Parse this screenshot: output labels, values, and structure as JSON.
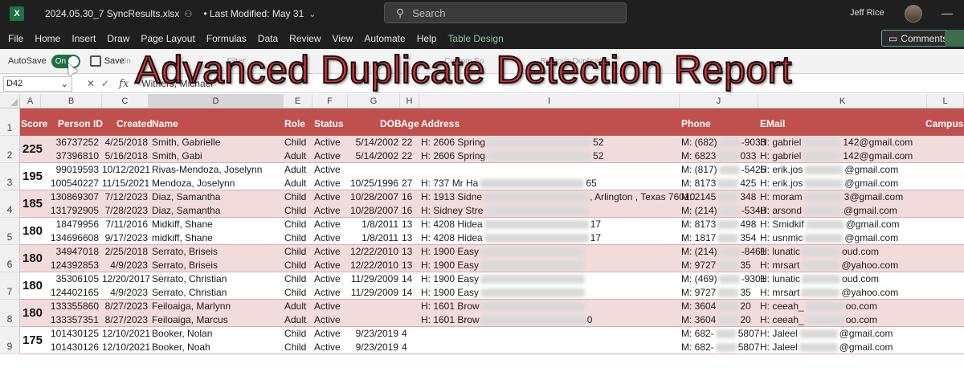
{
  "titlebar": {
    "app_icon": "excel-icon",
    "filename": "2024.05.30_7 SyncResults.xlsx",
    "last_modified": "• Last Modified: May 31",
    "search_placeholder": "Search",
    "user_name": "Jeff Rice"
  },
  "menu": {
    "items": [
      "File",
      "Home",
      "Insert",
      "Draw",
      "Page Layout",
      "Formulas",
      "Data",
      "Review",
      "View",
      "Automate",
      "Help",
      "Table Design"
    ],
    "comments_label": "Comments"
  },
  "ribbon": {
    "autosave_label": "AutoSave",
    "toggle_label": "On",
    "save_label": "Save",
    "undo_label": "Un",
    "filter_label": "Filter",
    "custom_label": "Custom So",
    "remove_dup_label": "Remove Duplicates"
  },
  "formula_bar": {
    "name_box": "D42",
    "formula_value": "Withers, Michael"
  },
  "banner": {
    "title": "Advanced Duplicate Detection Report"
  },
  "columns": [
    "A",
    "B",
    "C",
    "D",
    "E",
    "F",
    "G",
    "H",
    "I",
    "J",
    "K",
    "L"
  ],
  "headers": {
    "score": "Score",
    "person_id": "Person ID",
    "created": "Created",
    "name": "Name",
    "role": "Role",
    "status": "Status",
    "dob": "DOB",
    "age": "Age",
    "address": "Address",
    "phone": "Phone",
    "email": "EMail",
    "campus": "Campus"
  },
  "groups": [
    {
      "row_num": "2",
      "score": "225",
      "people": [
        {
          "id": "36737252",
          "created": "4/25/2018",
          "name": "Smith, Gabrielle",
          "role": "Child",
          "status": "Active",
          "dob": "5/14/2002",
          "age": "22",
          "addr_a": "H: 2606 Spring",
          "addr_b": "52",
          "phone_a": "M: (682)",
          "phone_b": "-9033",
          "email_a": "H: gabriel",
          "email_b": "142@gmail.com"
        },
        {
          "id": "37396810",
          "created": "5/16/2018",
          "name": "Smith, Gabi",
          "role": "Adult",
          "status": "Active",
          "dob": "5/14/2002",
          "age": "22",
          "addr_a": "H: 2606 Spring",
          "addr_b": "52",
          "phone_a": "M: 6823",
          "phone_b": "033",
          "email_a": "H: gabriel",
          "email_b": "142@gmail.com"
        }
      ]
    },
    {
      "row_num": "3",
      "score": "195",
      "people": [
        {
          "id": "99019593",
          "created": "10/12/2021",
          "name": "Rivas-Mendoza, Joselynn",
          "role": "Adult",
          "status": "Active",
          "dob": "",
          "age": "",
          "addr_a": "",
          "addr_b": "",
          "phone_a": "M: (817)",
          "phone_b": "-5425",
          "email_a": "H: erik.jos",
          "email_b": "@gmail.com"
        },
        {
          "id": "100540227",
          "created": "11/15/2021",
          "name": "Mendoza, Joselynn",
          "role": "Adult",
          "status": "Active",
          "dob": "10/25/1996",
          "age": "27",
          "addr_a": "H: 737 Mr Ha",
          "addr_b": "65",
          "phone_a": "M: 8173",
          "phone_b": "425",
          "email_a": "H: erik.jos",
          "email_b": "@gmail.com"
        }
      ]
    },
    {
      "row_num": "4",
      "score": "185",
      "people": [
        {
          "id": "130869307",
          "created": "7/12/2023",
          "name": "Diaz, Samantha",
          "role": "Child",
          "status": "Active",
          "dob": "10/28/2007",
          "age": "16",
          "addr_a": "H: 1913 Sidne",
          "addr_b": ", Arlington , Texas 76010",
          "phone_a": "M: 2145",
          "phone_b": "348",
          "email_a": "H: moram",
          "email_b": "3@gmail.com"
        },
        {
          "id": "131792905",
          "created": "7/28/2023",
          "name": "Diaz, Samantha",
          "role": "Child",
          "status": "Active",
          "dob": "10/28/2007",
          "age": "16",
          "addr_a": "H: Sidney Stre",
          "addr_b": "",
          "phone_a": "M: (214)",
          "phone_b": "-5348",
          "email_a": "H: arsond",
          "email_b": "@gmail.com"
        }
      ]
    },
    {
      "row_num": "5",
      "score": "180",
      "people": [
        {
          "id": "18479956",
          "created": "7/11/2016",
          "name": "Midkiff, Shane",
          "role": "Child",
          "status": "Active",
          "dob": "1/8/2011",
          "age": "13",
          "addr_a": "H: 4208 Hidea",
          "addr_b": "17",
          "phone_a": "M: 8173",
          "phone_b": "498",
          "email_a": "H: Smidkif",
          "email_b": "@gmail.com"
        },
        {
          "id": "134696608",
          "created": "9/17/2023",
          "name": "midkiff, Shane",
          "role": "Child",
          "status": "Active",
          "dob": "1/8/2011",
          "age": "13",
          "addr_a": "H: 4208 Hidea",
          "addr_b": "17",
          "phone_a": "M: 1817",
          "phone_b": "354",
          "email_a": "H: usnmic",
          "email_b": "@gmail.com"
        }
      ]
    },
    {
      "row_num": "6",
      "score": "180",
      "people": [
        {
          "id": "34947018",
          "created": "2/25/2018",
          "name": "Serrato, Briseis",
          "role": "Child",
          "status": "Active",
          "dob": "12/22/2010",
          "age": "13",
          "addr_a": "H: 1900 Easy",
          "addr_b": "",
          "phone_a": "M: (214)",
          "phone_b": "-8461",
          "email_a": "H: lunatic",
          "email_b": "oud.com"
        },
        {
          "id": "124392853",
          "created": "4/9/2023",
          "name": "Serrato, Briseis",
          "role": "Child",
          "status": "Active",
          "dob": "12/22/2010",
          "age": "13",
          "addr_a": "H: 1900 Easy",
          "addr_b": "",
          "phone_a": "M: 9727",
          "phone_b": "35",
          "email_a": "H: mrsart",
          "email_b": "@yahoo.com"
        }
      ]
    },
    {
      "row_num": "7",
      "score": "180",
      "people": [
        {
          "id": "35306105",
          "created": "12/20/2017",
          "name": "Serrato, Christian",
          "role": "Child",
          "status": "Active",
          "dob": "11/29/2009",
          "age": "14",
          "addr_a": "H: 1900 Easy",
          "addr_b": "",
          "phone_a": "M: (469)",
          "phone_b": "-9301",
          "email_a": "H: lunatic",
          "email_b": "oud.com"
        },
        {
          "id": "124402165",
          "created": "4/9/2023",
          "name": "Serrato, Christian",
          "role": "Child",
          "status": "Active",
          "dob": "11/29/2009",
          "age": "14",
          "addr_a": "H: 1900 Easy",
          "addr_b": "",
          "phone_a": "M: 9727",
          "phone_b": "35",
          "email_a": "H: mrsart",
          "email_b": "@yahoo.com"
        }
      ]
    },
    {
      "row_num": "8",
      "score": "180",
      "people": [
        {
          "id": "133355860",
          "created": "8/27/2023",
          "name": "Feiloaiga, Marlynn",
          "role": "Adult",
          "status": "Active",
          "dob": "",
          "age": "",
          "addr_a": "H: 1601 Brow",
          "addr_b": "",
          "phone_a": "M: 3604",
          "phone_b": "20",
          "email_a": "H: ceeah_",
          "email_b": "oo.com"
        },
        {
          "id": "133357351",
          "created": "8/27/2023",
          "name": "Feiloaiga, Marcus",
          "role": "Adult",
          "status": "Active",
          "dob": "",
          "age": "",
          "addr_a": "H: 1601 Brow",
          "addr_b": "0",
          "phone_a": "M: 3604",
          "phone_b": "20",
          "email_a": "H: ceeah_",
          "email_b": "oo.com"
        }
      ]
    },
    {
      "row_num": "9",
      "score": "175",
      "people": [
        {
          "id": "101430125",
          "created": "12/10/2021",
          "name": "Booker, Nolan",
          "role": "Child",
          "status": "Active",
          "dob": "9/23/2019",
          "age": "4",
          "addr_a": "",
          "addr_b": "",
          "phone_a": "M: 682-",
          "phone_b": "5807",
          "email_a": "H: Jaleel",
          "email_b": "@gmail.com"
        },
        {
          "id": "101430126",
          "created": "12/10/2021",
          "name": "Booker, Noah",
          "role": "Child",
          "status": "Active",
          "dob": "9/23/2019",
          "age": "4",
          "addr_a": "",
          "addr_b": "",
          "phone_a": "M: 682-",
          "phone_b": "5807",
          "email_a": "H: Jaleel",
          "email_b": "@gmail.com"
        }
      ]
    }
  ]
}
